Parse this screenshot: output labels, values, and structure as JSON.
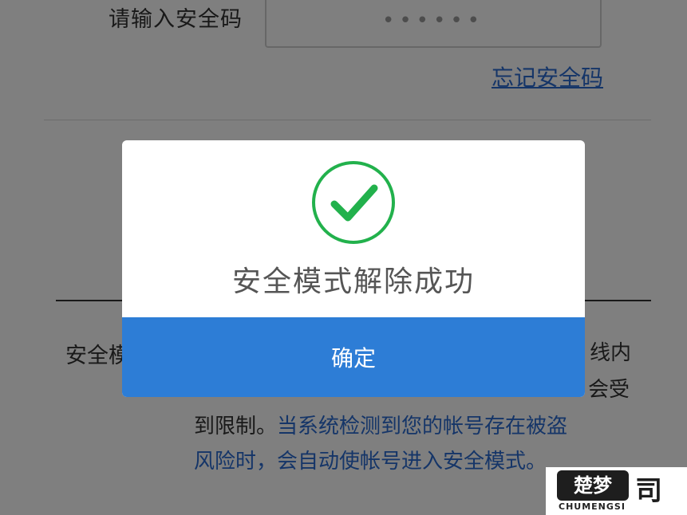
{
  "form": {
    "security_code_label": "请输入安全码",
    "security_code_value": "••••••",
    "forgot_link": "忘记安全码"
  },
  "description": {
    "label": "安全模",
    "row1_tail": "线内",
    "row2_tail": "会受",
    "row3_normal": "到限制。",
    "row3_highlight": "当系统检测到您的帐号存在被盗",
    "row4": "风险时，会自动使帐号进入安全模式。"
  },
  "bottom_partial": "",
  "dialog": {
    "icon": "check-circle-icon",
    "message": "安全模式解除成功",
    "confirm_label": "确定",
    "accent_color": "#2d7dd6",
    "success_color": "#22b14c"
  },
  "watermark": {
    "badge": "楚梦",
    "subtitle": "CHUMENGSI",
    "char": "司"
  }
}
